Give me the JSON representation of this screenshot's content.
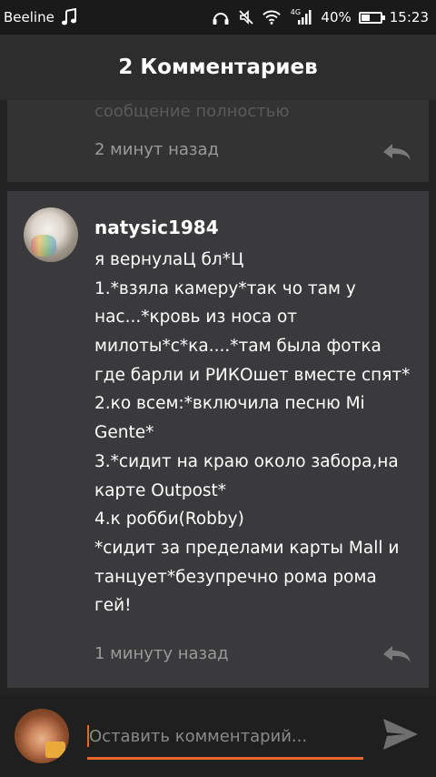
{
  "status_bar": {
    "carrier": "Beeline",
    "network_type": "4G",
    "battery_percent": "40%",
    "battery_level": 0.4,
    "time": "15:23",
    "icons": [
      "music-note-icon",
      "headphones-icon",
      "mute-icon",
      "wifi-icon",
      "signal-icon",
      "battery-icon"
    ]
  },
  "header": {
    "title": "2 Комментариев"
  },
  "comments": [
    {
      "partial_text": "сообщение полностью",
      "time": "2 минут назад",
      "reply_icon": "reply-icon"
    },
    {
      "username": "natysic1984",
      "lines": [
        "я вернулаЦ бл*Ц",
        "1.*взяла камеру*так чо там у",
        "нас...*кровь из носа от",
        "милоты*с*ка....*там была фотка",
        "где барли и РИКОшет вместе спят*",
        "2.ко всем:*включила песню Mi",
        "Gente*",
        "3.*сидит на краю около забора,на",
        "карте Outpost*",
        "4.к робби(Robby)",
        "*сидит за пределами карты Mall и",
        "танцует*безупречно рома рома",
        "гей!"
      ],
      "time": "1 минуту назад",
      "reply_icon": "reply-icon"
    }
  ],
  "composer": {
    "placeholder": "Оставить комментарий...",
    "value": "",
    "send_icon": "send-icon",
    "accent_color": "#e8652b"
  }
}
